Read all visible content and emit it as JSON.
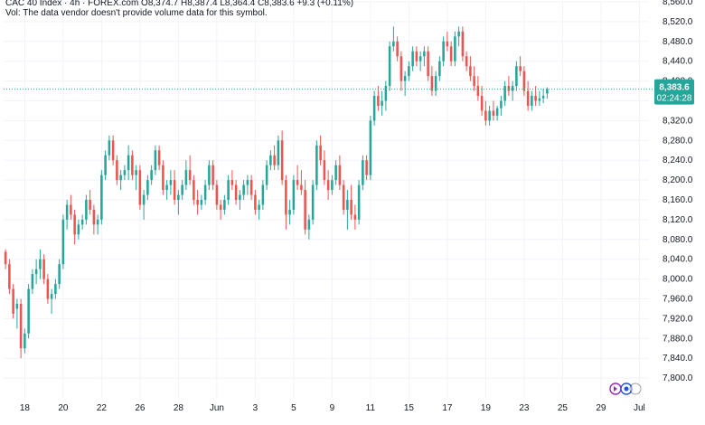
{
  "header": {
    "line1": "CAC 40 Index · 4h · FOREX.com  O8,374.7 H8,387.4 L8,364.4 C8,383.6 +9.3 (+0.11%)",
    "line2": "Vol: The data vendor doesn't provide volume data for this symbol."
  },
  "price_badge": {
    "price": "8,383.6",
    "countdown": "02:24:28",
    "color": "#26a69a"
  },
  "colors": {
    "up": "#26a69a",
    "down": "#ef5350",
    "grid": "#f0f3fa",
    "axis_text": "#131722"
  },
  "logo": {
    "icon": "tradingview-logo-icon"
  },
  "chart_data": {
    "type": "candlestick",
    "ylim": [
      7760,
      8560
    ],
    "yticks": [
      7800,
      7840,
      7880,
      7920,
      7960,
      8000,
      8040,
      8080,
      8120,
      8160,
      8200,
      8240,
      8280,
      8320,
      8360,
      8400,
      8440,
      8480,
      8520,
      8560
    ],
    "ytick_labels": [
      "7,800.0",
      "7,840.0",
      "7,880.0",
      "7,920.0",
      "7,960.0",
      "8,000.0",
      "8,040.0",
      "8,080.0",
      "8,120.0",
      "8,160.0",
      "8,200.0",
      "8,240.0",
      "8,280.0",
      "8,320.0",
      "8,360.0",
      "8,400.0",
      "8,440.0",
      "8,480.0",
      "8,520.0",
      "8,560.0"
    ],
    "xticks": [
      {
        "label": "18",
        "index": 5
      },
      {
        "label": "20",
        "index": 15
      },
      {
        "label": "22",
        "index": 25
      },
      {
        "label": "26",
        "index": 35
      },
      {
        "label": "28",
        "index": 45
      },
      {
        "label": "Jun",
        "index": 55
      },
      {
        "label": "3",
        "index": 65
      },
      {
        "label": "5",
        "index": 75
      },
      {
        "label": "9",
        "index": 85
      },
      {
        "label": "11",
        "index": 95
      },
      {
        "label": "15",
        "index": 105
      },
      {
        "label": "17",
        "index": 115
      },
      {
        "label": "19",
        "index": 125
      },
      {
        "label": "23",
        "index": 135
      },
      {
        "label": "25",
        "index": 145
      },
      {
        "label": "29",
        "index": 155
      },
      {
        "label": "Jul",
        "index": 165
      }
    ],
    "last_price": 8383.6,
    "ohlc": [
      [
        8055,
        8060,
        8020,
        8030
      ],
      [
        8030,
        8040,
        7970,
        7980
      ],
      [
        7980,
        7990,
        7920,
        7930
      ],
      [
        7940,
        7960,
        7900,
        7950
      ],
      [
        7950,
        7960,
        7840,
        7860
      ],
      [
        7860,
        7900,
        7850,
        7890
      ],
      [
        7890,
        7990,
        7880,
        7980
      ],
      [
        7980,
        8020,
        7970,
        8010
      ],
      [
        8010,
        8040,
        7990,
        8020
      ],
      [
        8020,
        8060,
        8000,
        8040
      ],
      [
        8040,
        8050,
        7990,
        8000
      ],
      [
        8000,
        8010,
        7950,
        7960
      ],
      [
        7960,
        7980,
        7930,
        7970
      ],
      [
        7970,
        8000,
        7960,
        7990
      ],
      [
        7990,
        8040,
        7980,
        8030
      ],
      [
        8030,
        8130,
        8020,
        8120
      ],
      [
        8120,
        8160,
        8100,
        8150
      ],
      [
        8150,
        8170,
        8120,
        8130
      ],
      [
        8130,
        8140,
        8070,
        8090
      ],
      [
        8090,
        8120,
        8080,
        8110
      ],
      [
        8110,
        8130,
        8100,
        8120
      ],
      [
        8120,
        8170,
        8110,
        8160
      ],
      [
        8160,
        8180,
        8130,
        8140
      ],
      [
        8140,
        8150,
        8090,
        8110
      ],
      [
        8110,
        8130,
        8090,
        8120
      ],
      [
        8120,
        8220,
        8110,
        8210
      ],
      [
        8210,
        8260,
        8200,
        8250
      ],
      [
        8250,
        8290,
        8240,
        8280
      ],
      [
        8280,
        8290,
        8230,
        8240
      ],
      [
        8240,
        8250,
        8190,
        8200
      ],
      [
        8200,
        8220,
        8180,
        8210
      ],
      [
        8210,
        8230,
        8200,
        8220
      ],
      [
        8220,
        8270,
        8200,
        8250
      ],
      [
        8250,
        8260,
        8200,
        8210
      ],
      [
        8210,
        8230,
        8180,
        8220
      ],
      [
        8220,
        8230,
        8140,
        8150
      ],
      [
        8150,
        8180,
        8120,
        8170
      ],
      [
        8170,
        8210,
        8160,
        8200
      ],
      [
        8200,
        8230,
        8190,
        8220
      ],
      [
        8220,
        8270,
        8210,
        8260
      ],
      [
        8260,
        8270,
        8220,
        8230
      ],
      [
        8230,
        8240,
        8170,
        8180
      ],
      [
        8180,
        8200,
        8160,
        8190
      ],
      [
        8190,
        8220,
        8170,
        8200
      ],
      [
        8200,
        8220,
        8150,
        8160
      ],
      [
        8160,
        8180,
        8130,
        8170
      ],
      [
        8170,
        8200,
        8160,
        8190
      ],
      [
        8190,
        8240,
        8180,
        8220
      ],
      [
        8220,
        8250,
        8190,
        8200
      ],
      [
        8200,
        8210,
        8150,
        8160
      ],
      [
        8160,
        8180,
        8130,
        8150
      ],
      [
        8150,
        8170,
        8140,
        8160
      ],
      [
        8160,
        8200,
        8150,
        8190
      ],
      [
        8190,
        8240,
        8180,
        8230
      ],
      [
        8230,
        8240,
        8180,
        8190
      ],
      [
        8190,
        8200,
        8140,
        8150
      ],
      [
        8150,
        8160,
        8120,
        8140
      ],
      [
        8140,
        8170,
        8130,
        8160
      ],
      [
        8160,
        8210,
        8150,
        8200
      ],
      [
        8200,
        8220,
        8180,
        8190
      ],
      [
        8190,
        8200,
        8150,
        8160
      ],
      [
        8160,
        8180,
        8140,
        8170
      ],
      [
        8170,
        8200,
        8160,
        8190
      ],
      [
        8190,
        8210,
        8170,
        8200
      ],
      [
        8200,
        8210,
        8160,
        8170
      ],
      [
        8170,
        8180,
        8130,
        8140
      ],
      [
        8140,
        8160,
        8120,
        8150
      ],
      [
        8150,
        8200,
        8140,
        8190
      ],
      [
        8190,
        8240,
        8180,
        8230
      ],
      [
        8230,
        8260,
        8220,
        8250
      ],
      [
        8250,
        8270,
        8220,
        8230
      ],
      [
        8230,
        8290,
        8220,
        8280
      ],
      [
        8280,
        8300,
        8190,
        8200
      ],
      [
        8200,
        8210,
        8100,
        8130
      ],
      [
        8130,
        8160,
        8110,
        8140
      ],
      [
        8140,
        8210,
        8130,
        8200
      ],
      [
        8200,
        8230,
        8180,
        8190
      ],
      [
        8190,
        8220,
        8170,
        8180
      ],
      [
        8180,
        8200,
        8090,
        8100
      ],
      [
        8100,
        8130,
        8080,
        8120
      ],
      [
        8120,
        8200,
        8110,
        8190
      ],
      [
        8190,
        8280,
        8180,
        8270
      ],
      [
        8270,
        8290,
        8230,
        8240
      ],
      [
        8240,
        8260,
        8190,
        8200
      ],
      [
        8200,
        8220,
        8160,
        8180
      ],
      [
        8180,
        8210,
        8170,
        8200
      ],
      [
        8200,
        8240,
        8190,
        8230
      ],
      [
        8230,
        8250,
        8180,
        8190
      ],
      [
        8190,
        8200,
        8130,
        8140
      ],
      [
        8140,
        8180,
        8100,
        8160
      ],
      [
        8160,
        8190,
        8120,
        8130
      ],
      [
        8130,
        8150,
        8100,
        8120
      ],
      [
        8120,
        8200,
        8110,
        8190
      ],
      [
        8190,
        8250,
        8180,
        8240
      ],
      [
        8240,
        8250,
        8200,
        8210
      ],
      [
        8210,
        8330,
        8200,
        8320
      ],
      [
        8320,
        8380,
        8310,
        8370
      ],
      [
        8370,
        8390,
        8340,
        8350
      ],
      [
        8350,
        8380,
        8330,
        8360
      ],
      [
        8360,
        8400,
        8340,
        8390
      ],
      [
        8390,
        8480,
        8380,
        8470
      ],
      [
        8470,
        8510,
        8460,
        8480
      ],
      [
        8480,
        8490,
        8440,
        8450
      ],
      [
        8450,
        8460,
        8380,
        8400
      ],
      [
        8400,
        8420,
        8370,
        8410
      ],
      [
        8410,
        8440,
        8400,
        8430
      ],
      [
        8430,
        8470,
        8420,
        8460
      ],
      [
        8460,
        8470,
        8430,
        8440
      ],
      [
        8440,
        8460,
        8420,
        8450
      ],
      [
        8450,
        8470,
        8430,
        8460
      ],
      [
        8460,
        8470,
        8400,
        8410
      ],
      [
        8410,
        8430,
        8370,
        8380
      ],
      [
        8380,
        8420,
        8370,
        8410
      ],
      [
        8410,
        8450,
        8400,
        8440
      ],
      [
        8440,
        8490,
        8430,
        8480
      ],
      [
        8480,
        8500,
        8460,
        8470
      ],
      [
        8470,
        8480,
        8430,
        8440
      ],
      [
        8440,
        8500,
        8430,
        8490
      ],
      [
        8490,
        8510,
        8470,
        8500
      ],
      [
        8500,
        8510,
        8440,
        8450
      ],
      [
        8450,
        8460,
        8420,
        8430
      ],
      [
        8430,
        8450,
        8400,
        8410
      ],
      [
        8410,
        8430,
        8380,
        8390
      ],
      [
        8390,
        8410,
        8360,
        8370
      ],
      [
        8370,
        8390,
        8330,
        8340
      ],
      [
        8340,
        8360,
        8310,
        8320
      ],
      [
        8320,
        8350,
        8310,
        8340
      ],
      [
        8340,
        8360,
        8320,
        8330
      ],
      [
        8330,
        8350,
        8320,
        8345
      ],
      [
        8345,
        8370,
        8330,
        8360
      ],
      [
        8360,
        8400,
        8350,
        8390
      ],
      [
        8390,
        8410,
        8370,
        8380
      ],
      [
        8380,
        8400,
        8360,
        8390
      ],
      [
        8390,
        8440,
        8380,
        8430
      ],
      [
        8430,
        8450,
        8410,
        8420
      ],
      [
        8420,
        8430,
        8370,
        8380
      ],
      [
        8380,
        8400,
        8340,
        8350
      ],
      [
        8350,
        8380,
        8340,
        8370
      ],
      [
        8370,
        8390,
        8350,
        8360
      ],
      [
        8360,
        8380,
        8350,
        8365
      ],
      [
        8365,
        8385,
        8355,
        8370
      ],
      [
        8374.7,
        8387.4,
        8364.4,
        8383.6
      ]
    ]
  }
}
